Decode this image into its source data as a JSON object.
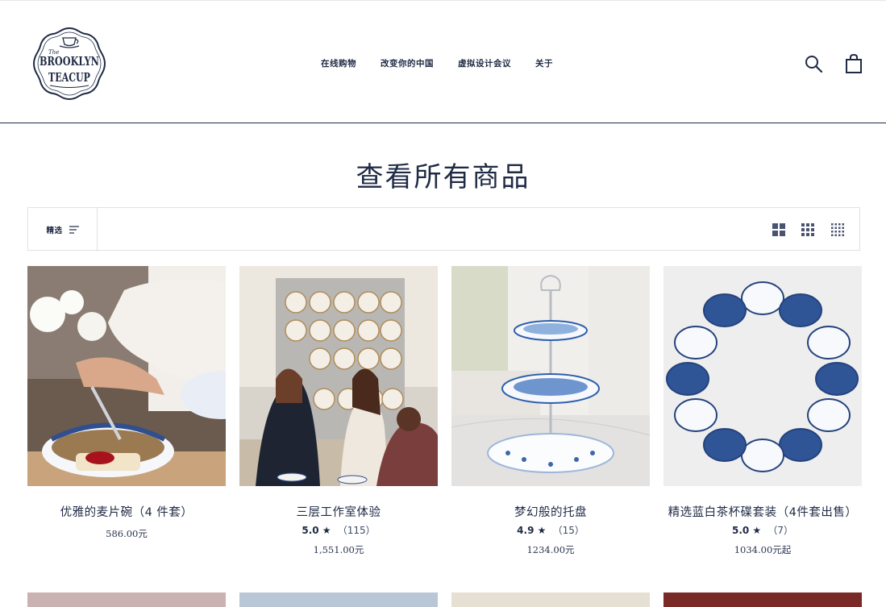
{
  "brand": {
    "logo_lines": [
      "The",
      "BROOKLYN",
      "TEACUP"
    ],
    "colors": {
      "navy": "#1f2a44",
      "border": "#e1e1e1",
      "blue": "#2f4f8f"
    }
  },
  "nav": [
    {
      "label": "在线购物"
    },
    {
      "label": "改变你的中国"
    },
    {
      "label": "虚拟设计会议"
    },
    {
      "label": "关于"
    }
  ],
  "header_icons": {
    "search": "search-icon",
    "cart": "shopping-bag-icon"
  },
  "page": {
    "title": "查看所有商品"
  },
  "toolbar": {
    "filter_label": "精选",
    "filter_icon": "sort-lines-icon",
    "views": [
      "grid-large-icon",
      "grid-medium-icon",
      "grid-small-icon"
    ]
  },
  "products": [
    {
      "title": "优雅的麦片碗（4 件套）",
      "rating": "",
      "reviews": "",
      "price": "586.00元"
    },
    {
      "title": "三层工作室体验",
      "rating": "5.0",
      "reviews": "（115）",
      "price": "1,551.00元"
    },
    {
      "title": "梦幻般的托盘",
      "rating": "4.9",
      "reviews": "（15）",
      "price": "1234.00元"
    },
    {
      "title": "精选蓝白茶杯碟套装（4件套出售）",
      "rating": "5.0",
      "reviews": "（7）",
      "price": "1034.00元起"
    }
  ]
}
